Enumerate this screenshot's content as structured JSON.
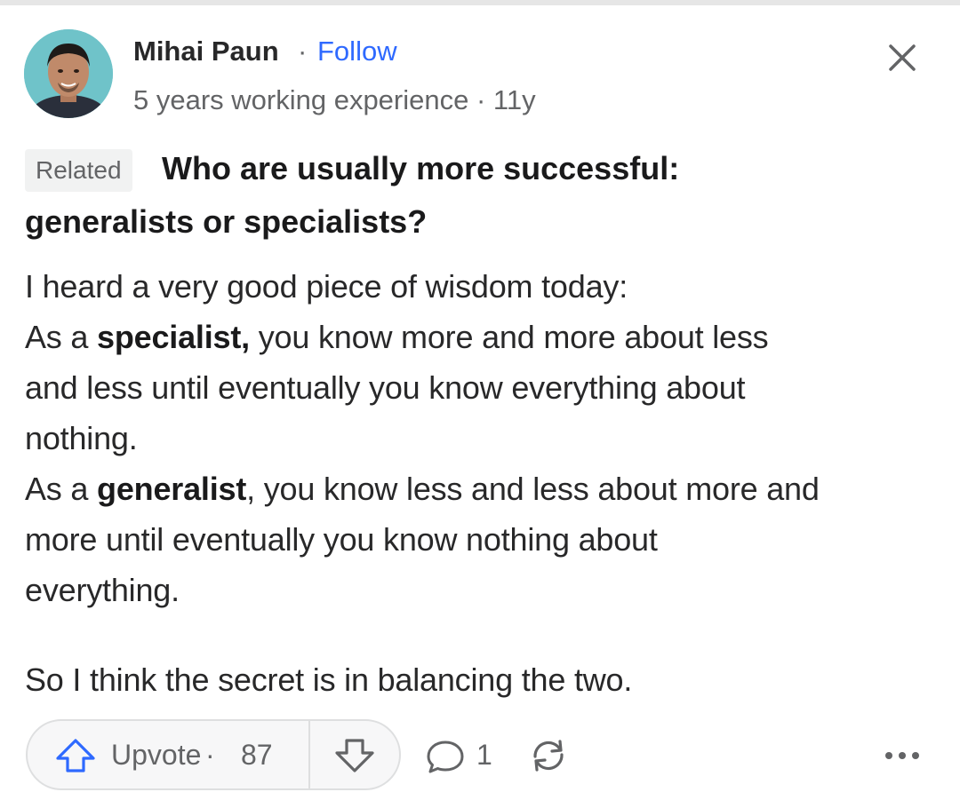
{
  "author": {
    "name": "Mihai Paun",
    "separator": "·",
    "follow_label": "Follow",
    "credential": "5 years working experience · 11y"
  },
  "post": {
    "related_label": "Related",
    "question_line1": "Who are usually more successful:",
    "question_line2": "generalists or specialists?",
    "body": {
      "line1": "I heard a very good piece of wisdom today:",
      "line2_pre": "As a ",
      "line2_bold": "specialist,",
      "line2_post": " you know more and more about less",
      "line3": "and less until eventually you know everything about",
      "line4": "nothing.",
      "line5_pre": "As a ",
      "line5_bold": "generalist",
      "line5_post": ", you know less and less about more and",
      "line6": "more until eventually you know nothing about",
      "line7": "everything.",
      "line8": "So I think the secret is in balancing the two."
    }
  },
  "actions": {
    "upvote_label": "Upvote",
    "upvote_separator": "·",
    "upvote_count": "87",
    "comment_count": "1"
  },
  "icons": {
    "close": "close-icon",
    "upvote": "arrow-up-icon",
    "downvote": "arrow-down-icon",
    "comment": "comment-bubble-icon",
    "share": "share-icon",
    "more": "more-dots-icon"
  },
  "colors": {
    "accent": "#2e69ff",
    "upvote_icon": "#2e69ff",
    "text_primary": "#282829",
    "text_secondary": "#636466",
    "avatar_bg": "#7cc9cf"
  }
}
